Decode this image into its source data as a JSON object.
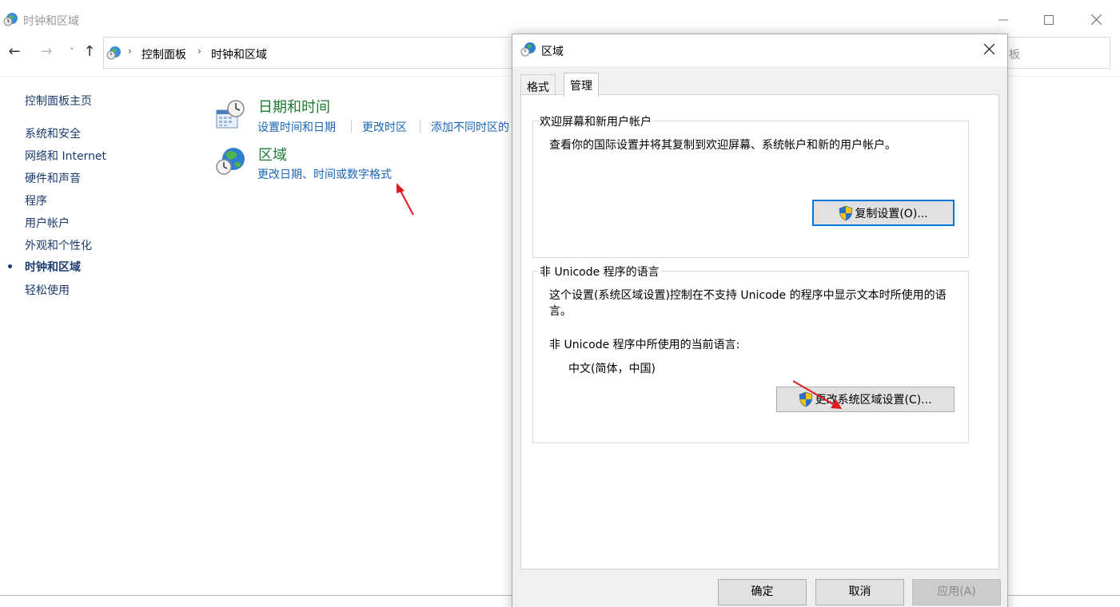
{
  "window": {
    "title": "时钟和区域",
    "minimize_icon": "minimize-icon",
    "maximize_icon": "maximize-icon",
    "close_icon": "close-icon"
  },
  "navbar": {
    "back_symbol": "←",
    "forward_symbol": "→",
    "recent_symbol": "˅",
    "up_symbol": "↑",
    "breadcrumbs": [
      "控制面板",
      "时钟和区域"
    ],
    "search_partial": "板"
  },
  "sidebar": {
    "items": [
      {
        "label": "控制面板主页"
      },
      {
        "label": "系统和安全"
      },
      {
        "label": "网络和 Internet"
      },
      {
        "label": "硬件和声音"
      },
      {
        "label": "程序"
      },
      {
        "label": "用户帐户"
      },
      {
        "label": "外观和个性化"
      },
      {
        "label": "时钟和区域",
        "current": true
      },
      {
        "label": "轻松使用"
      }
    ]
  },
  "categories": {
    "datetime": {
      "title": "日期和时间",
      "links": [
        "设置时间和日期",
        "更改时区",
        "添加不同时区的"
      ]
    },
    "region": {
      "title": "区域",
      "links": [
        "更改日期、时间或数字格式"
      ]
    }
  },
  "dialog": {
    "title": "区域",
    "tabs": [
      "格式",
      "管理"
    ],
    "active_tab": "管理",
    "welcome_group": {
      "legend": "欢迎屏幕和新用户帐户",
      "description": "查看你的国际设置并将其复制到欢迎屏幕、系统帐户和新的用户帐户。",
      "copy_button": "复制设置(O)..."
    },
    "unicode_group": {
      "legend": "非 Unicode 程序的语言",
      "description": "这个设置(系统区域设置)控制在不支持 Unicode 的程序中显示文本时所使用的语言。",
      "current_label": "非 Unicode 程序中所使用的当前语言:",
      "current_value": "中文(简体，中国)",
      "change_button": "更改系统区域设置(C)..."
    },
    "buttons": {
      "ok": "确定",
      "cancel": "取消",
      "apply": "应用(A)"
    }
  },
  "colors": {
    "link": "#1a65b8",
    "category_title": "#1e7a33",
    "sidebar_text": "#1a3b6e",
    "annotation_arrow": "#e0191f"
  }
}
